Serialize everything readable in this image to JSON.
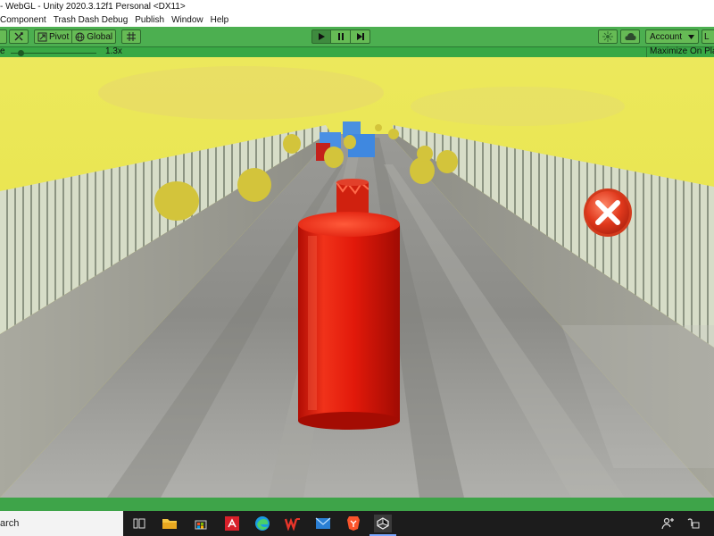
{
  "window": {
    "title": "- WebGL - Unity 2020.3.12f1 Personal <DX11>"
  },
  "menu": {
    "items": [
      "Component",
      "Trash Dash Debug",
      "Publish",
      "Window",
      "Help"
    ]
  },
  "toolbar": {
    "pivot_label": "Pivot",
    "global_label": "Global",
    "account_label": "Account",
    "layers_label": "L"
  },
  "gamebar": {
    "scale_label": "e",
    "scale_value": "1.3x",
    "scale_fraction": 0.12,
    "maximize_label": "Maximize On Play"
  },
  "taskbar": {
    "search_placeholder": "arch"
  },
  "colors": {
    "toolbar": "#4caf50",
    "gamebar": "#39a845",
    "sky": "#e8e44a",
    "player": "#e01a0a",
    "coin": "#d0c23a",
    "fence": "#d4dcc4",
    "close_button": "#e03a1f",
    "taskbar": "#1c1c1c"
  },
  "icons": {
    "move_tool": "move-tool-icon",
    "pivot": "pivot-icon",
    "global": "globe-icon",
    "snap": "snap-grid-icon",
    "play": "play-icon",
    "pause": "pause-icon",
    "step": "step-icon",
    "collab": "collab-icon",
    "cloud": "cloud-icon",
    "close_game": "close-x-icon"
  }
}
